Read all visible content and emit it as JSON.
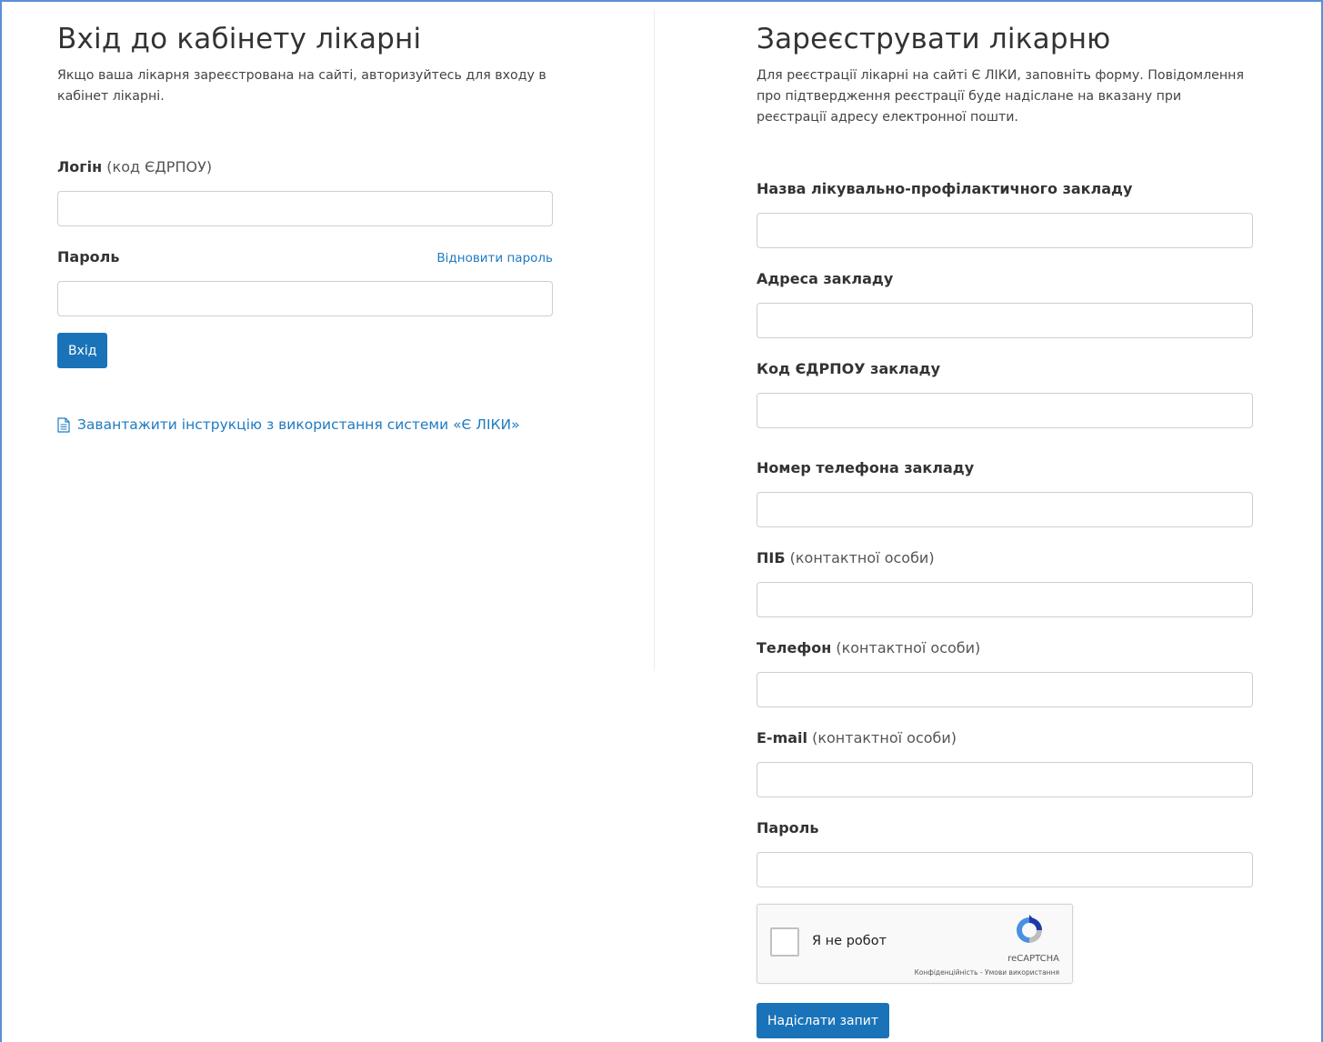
{
  "login": {
    "title": "Вхід до кабінету лікарні",
    "intro": "Якщо ваша лікарня зареєстрована на сайті, авторизуйтесь для входу в кабінет лікарні.",
    "login_label": "Логін",
    "login_hint": "(код ЄДРПОУ)",
    "login_value": "",
    "password_label": "Пароль",
    "password_value": "",
    "restore_link": "Відновити пароль",
    "submit_label": "Вхід",
    "instruction_link": "Завантажити інструкцію з використання системи «Є ЛІКИ»"
  },
  "register": {
    "title": "Зареєструвати лікарню",
    "intro": "Для реєстрації лікарні на сайті Є ЛІКИ, заповніть форму. Повідомлення про підтвердження реєстрації буде надіслане на вказану при реєстрації адресу електронної пошти.",
    "fields": [
      {
        "label": "Назва лікувально-профілактичного закладу",
        "hint": "",
        "value": ""
      },
      {
        "label": "Адреса закладу",
        "hint": "",
        "value": ""
      },
      {
        "label": "Код ЄДРПОУ закладу",
        "hint": "",
        "value": ""
      },
      {
        "label": "Номер телефона закладу",
        "hint": "",
        "value": ""
      },
      {
        "label": "ПІБ",
        "hint": "(контактної особи)",
        "value": ""
      },
      {
        "label": "Телефон",
        "hint": "(контактної особи)",
        "value": ""
      },
      {
        "label": "E-mail",
        "hint": "(контактної особи)",
        "value": ""
      },
      {
        "label": "Пароль",
        "hint": "",
        "value": ""
      }
    ],
    "captcha": {
      "label": "Я не робот",
      "brand": "reCAPTCHA",
      "terms": "Конфіденційність - Умови використання"
    },
    "submit_label": "Надіслати запит"
  },
  "colors": {
    "primary": "#1a73b8",
    "link": "#1f7bc1",
    "frame": "#5b8fd6"
  }
}
